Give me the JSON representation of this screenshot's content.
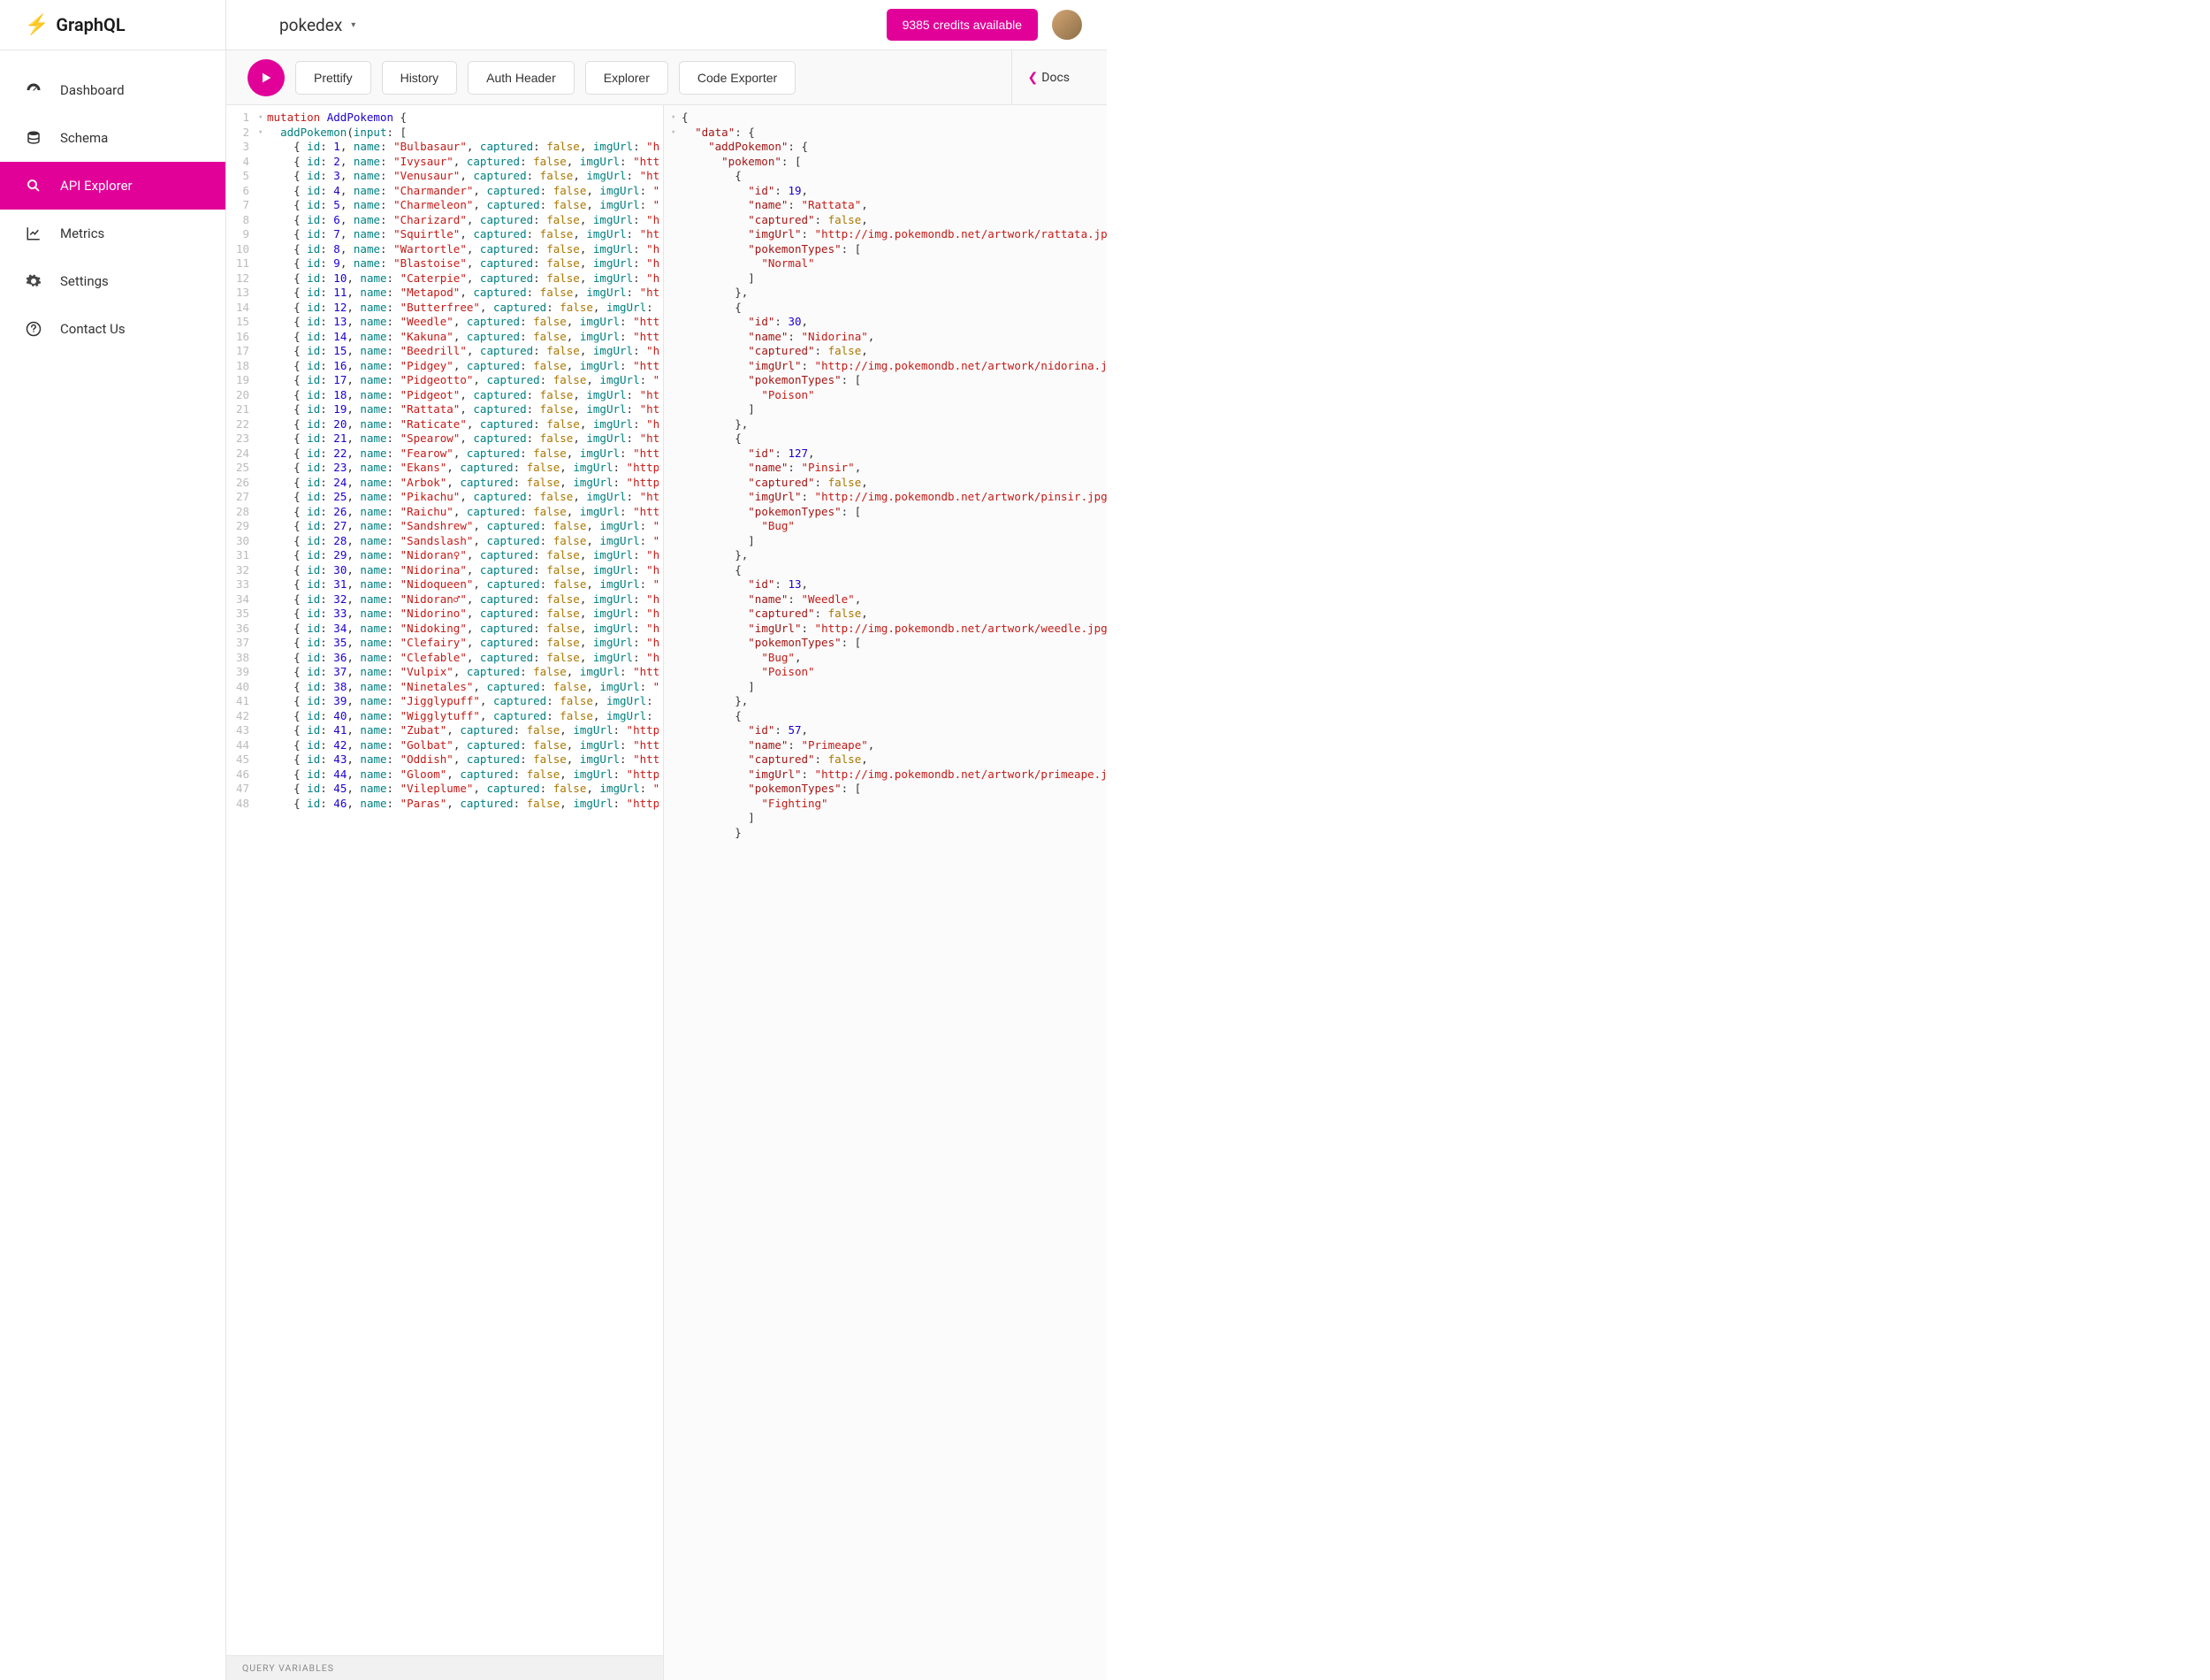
{
  "logo": "GraphQL",
  "nav": {
    "dashboard": "Dashboard",
    "schema": "Schema",
    "explorer": "API Explorer",
    "metrics": "Metrics",
    "settings": "Settings",
    "contact": "Contact Us"
  },
  "project": "pokedex",
  "credits": "9385 credits available",
  "toolbar": {
    "prettify": "Prettify",
    "history": "History",
    "auth": "Auth Header",
    "explorer": "Explorer",
    "code_exporter": "Code Exporter",
    "docs": "Docs"
  },
  "query_vars_label": "QUERY VARIABLES",
  "mutation_name": "AddPokemon",
  "field_name": "addPokemon",
  "arg_name": "input",
  "captured_default": "false",
  "imgUrl_prefix": "http://img.",
  "pokemon": [
    {
      "id": 1,
      "name": "Bulbasaur"
    },
    {
      "id": 2,
      "name": "Ivysaur"
    },
    {
      "id": 3,
      "name": "Venusaur"
    },
    {
      "id": 4,
      "name": "Charmander"
    },
    {
      "id": 5,
      "name": "Charmeleon"
    },
    {
      "id": 6,
      "name": "Charizard"
    },
    {
      "id": 7,
      "name": "Squirtle"
    },
    {
      "id": 8,
      "name": "Wartortle"
    },
    {
      "id": 9,
      "name": "Blastoise"
    },
    {
      "id": 10,
      "name": "Caterpie"
    },
    {
      "id": 11,
      "name": "Metapod"
    },
    {
      "id": 12,
      "name": "Butterfree"
    },
    {
      "id": 13,
      "name": "Weedle"
    },
    {
      "id": 14,
      "name": "Kakuna"
    },
    {
      "id": 15,
      "name": "Beedrill"
    },
    {
      "id": 16,
      "name": "Pidgey"
    },
    {
      "id": 17,
      "name": "Pidgeotto"
    },
    {
      "id": 18,
      "name": "Pidgeot"
    },
    {
      "id": 19,
      "name": "Rattata"
    },
    {
      "id": 20,
      "name": "Raticate"
    },
    {
      "id": 21,
      "name": "Spearow"
    },
    {
      "id": 22,
      "name": "Fearow"
    },
    {
      "id": 23,
      "name": "Ekans"
    },
    {
      "id": 24,
      "name": "Arbok"
    },
    {
      "id": 25,
      "name": "Pikachu"
    },
    {
      "id": 26,
      "name": "Raichu"
    },
    {
      "id": 27,
      "name": "Sandshrew"
    },
    {
      "id": 28,
      "name": "Sandslash"
    },
    {
      "id": 29,
      "name": "Nidoran♀"
    },
    {
      "id": 30,
      "name": "Nidorina"
    },
    {
      "id": 31,
      "name": "Nidoqueen"
    },
    {
      "id": 32,
      "name": "Nidoran♂"
    },
    {
      "id": 33,
      "name": "Nidorino"
    },
    {
      "id": 34,
      "name": "Nidoking"
    },
    {
      "id": 35,
      "name": "Clefairy"
    },
    {
      "id": 36,
      "name": "Clefable"
    },
    {
      "id": 37,
      "name": "Vulpix"
    },
    {
      "id": 38,
      "name": "Ninetales"
    },
    {
      "id": 39,
      "name": "Jigglypuff"
    },
    {
      "id": 40,
      "name": "Wigglytuff"
    },
    {
      "id": 41,
      "name": "Zubat"
    },
    {
      "id": 42,
      "name": "Golbat"
    },
    {
      "id": 43,
      "name": "Oddish"
    },
    {
      "id": 44,
      "name": "Gloom"
    },
    {
      "id": 45,
      "name": "Vileplume"
    },
    {
      "id": 46,
      "name": "Paras"
    }
  ],
  "response": {
    "root": "data",
    "field": "addPokemon",
    "list": "pokemon",
    "imgUrl_base": "http://img.pokemondb.net/artwork/",
    "items": [
      {
        "id": 19,
        "name": "Rattata",
        "captured": "false",
        "slug": "rattata",
        "types": [
          "Normal"
        ]
      },
      {
        "id": 30,
        "name": "Nidorina",
        "captured": "false",
        "slug": "nidorina",
        "types": [
          "Poison"
        ]
      },
      {
        "id": 127,
        "name": "Pinsir",
        "captured": "false",
        "slug": "pinsir",
        "types": [
          "Bug"
        ]
      },
      {
        "id": 13,
        "name": "Weedle",
        "captured": "false",
        "slug": "weedle",
        "types": [
          "Bug",
          "Poison"
        ]
      },
      {
        "id": 57,
        "name": "Primeape",
        "captured": "false",
        "slug": "primeape",
        "types": [
          "Fighting"
        ]
      }
    ]
  }
}
